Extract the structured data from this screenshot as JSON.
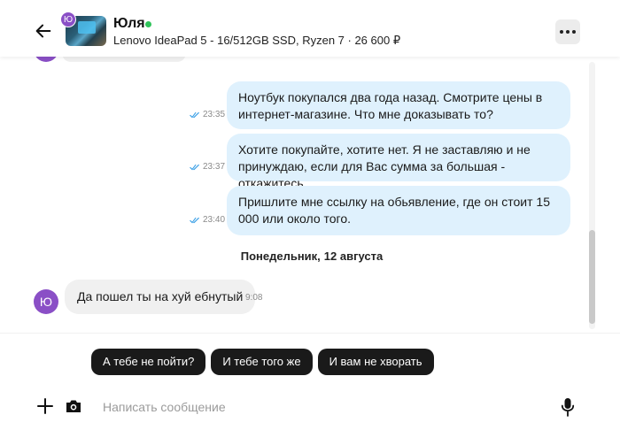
{
  "header": {
    "user_name": "Юля",
    "avatar_letter": "Ю",
    "listing_title": "Lenovo IdeaPad 5 - 16/512GB SSD, Ryzen 7 · 26 600 ₽",
    "icons": {
      "back": "arrow-left-icon",
      "more": "more-dots-icon"
    },
    "online_color": "#2fc35a"
  },
  "messages": [
    {
      "direction": "out",
      "text": "Ноутбук покупался два года назад. Смотрите цены в интернет-магазине. Что мне доказывать то?",
      "time": "23:35",
      "status": "read"
    },
    {
      "direction": "out",
      "text": "Хотите покупайте, хотите нет. Я не заставляю и не принуждаю, если для Вас сумма за большая - откажитесь.",
      "time": "23:37",
      "status": "read"
    },
    {
      "direction": "out",
      "text": "Пришлите мне ссылку на обьявление, где он стоит 15 000 или около того.",
      "time": "23:40",
      "status": "read"
    },
    {
      "direction": "in",
      "text": "Да пошел ты на хуй ебнутый",
      "time": "9:08",
      "avatar_letter": "Ю"
    }
  ],
  "date_separator": {
    "weekday": "Понедельник,",
    "date": "12 августа"
  },
  "quick_replies": [
    "А тебе не пойти?",
    "И тебе того же",
    "И вам не хворать"
  ],
  "composer": {
    "placeholder": "Написать сообщение",
    "value": "",
    "icons": {
      "add": "plus-icon",
      "camera": "camera-icon",
      "mic": "microphone-icon"
    }
  },
  "colors": {
    "accent_avatar": "#8a4fc6",
    "outgoing_bubble": "#dff1fd",
    "incoming_bubble": "#f0f0f0",
    "quick_reply_bg": "#1a1a1a",
    "read_check": "#3ba0e6"
  }
}
